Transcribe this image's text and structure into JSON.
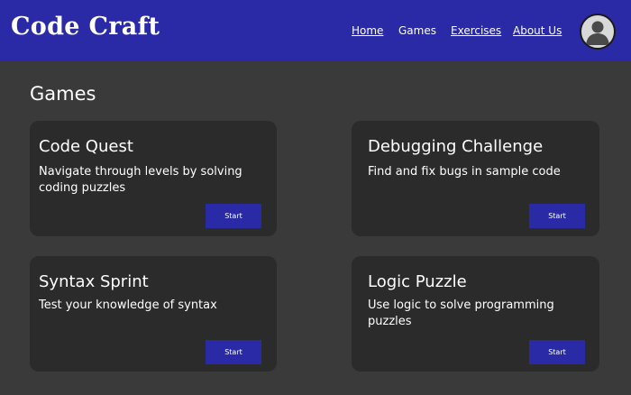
{
  "header": {
    "logo": "Code Craft",
    "nav": [
      {
        "label": "Home",
        "underlined": true
      },
      {
        "label": "Games",
        "underlined": false
      },
      {
        "label": "Exercises",
        "underlined": true
      },
      {
        "label": "About Us",
        "underlined": true
      }
    ],
    "avatar_icon": "user-avatar-icon"
  },
  "main": {
    "title": "Games",
    "cards": [
      {
        "title": "Code Quest",
        "description": "Navigate through levels by solving coding puzzles",
        "button": "Start"
      },
      {
        "title": "Debugging Challenge",
        "description": "Find and fix bugs in sample code",
        "button": "Start"
      },
      {
        "title": "Syntax Sprint",
        "description": "Test your knowledge of syntax",
        "button": "Start"
      },
      {
        "title": "Logic Puzzle",
        "description": "Use logic to solve programming puzzles",
        "button": "Start"
      }
    ]
  },
  "colors": {
    "header_bg": "#2a2aa6",
    "page_bg": "#3a3a3a",
    "card_bg": "#2b2b2b",
    "button_bg": "#2a2aa6"
  }
}
